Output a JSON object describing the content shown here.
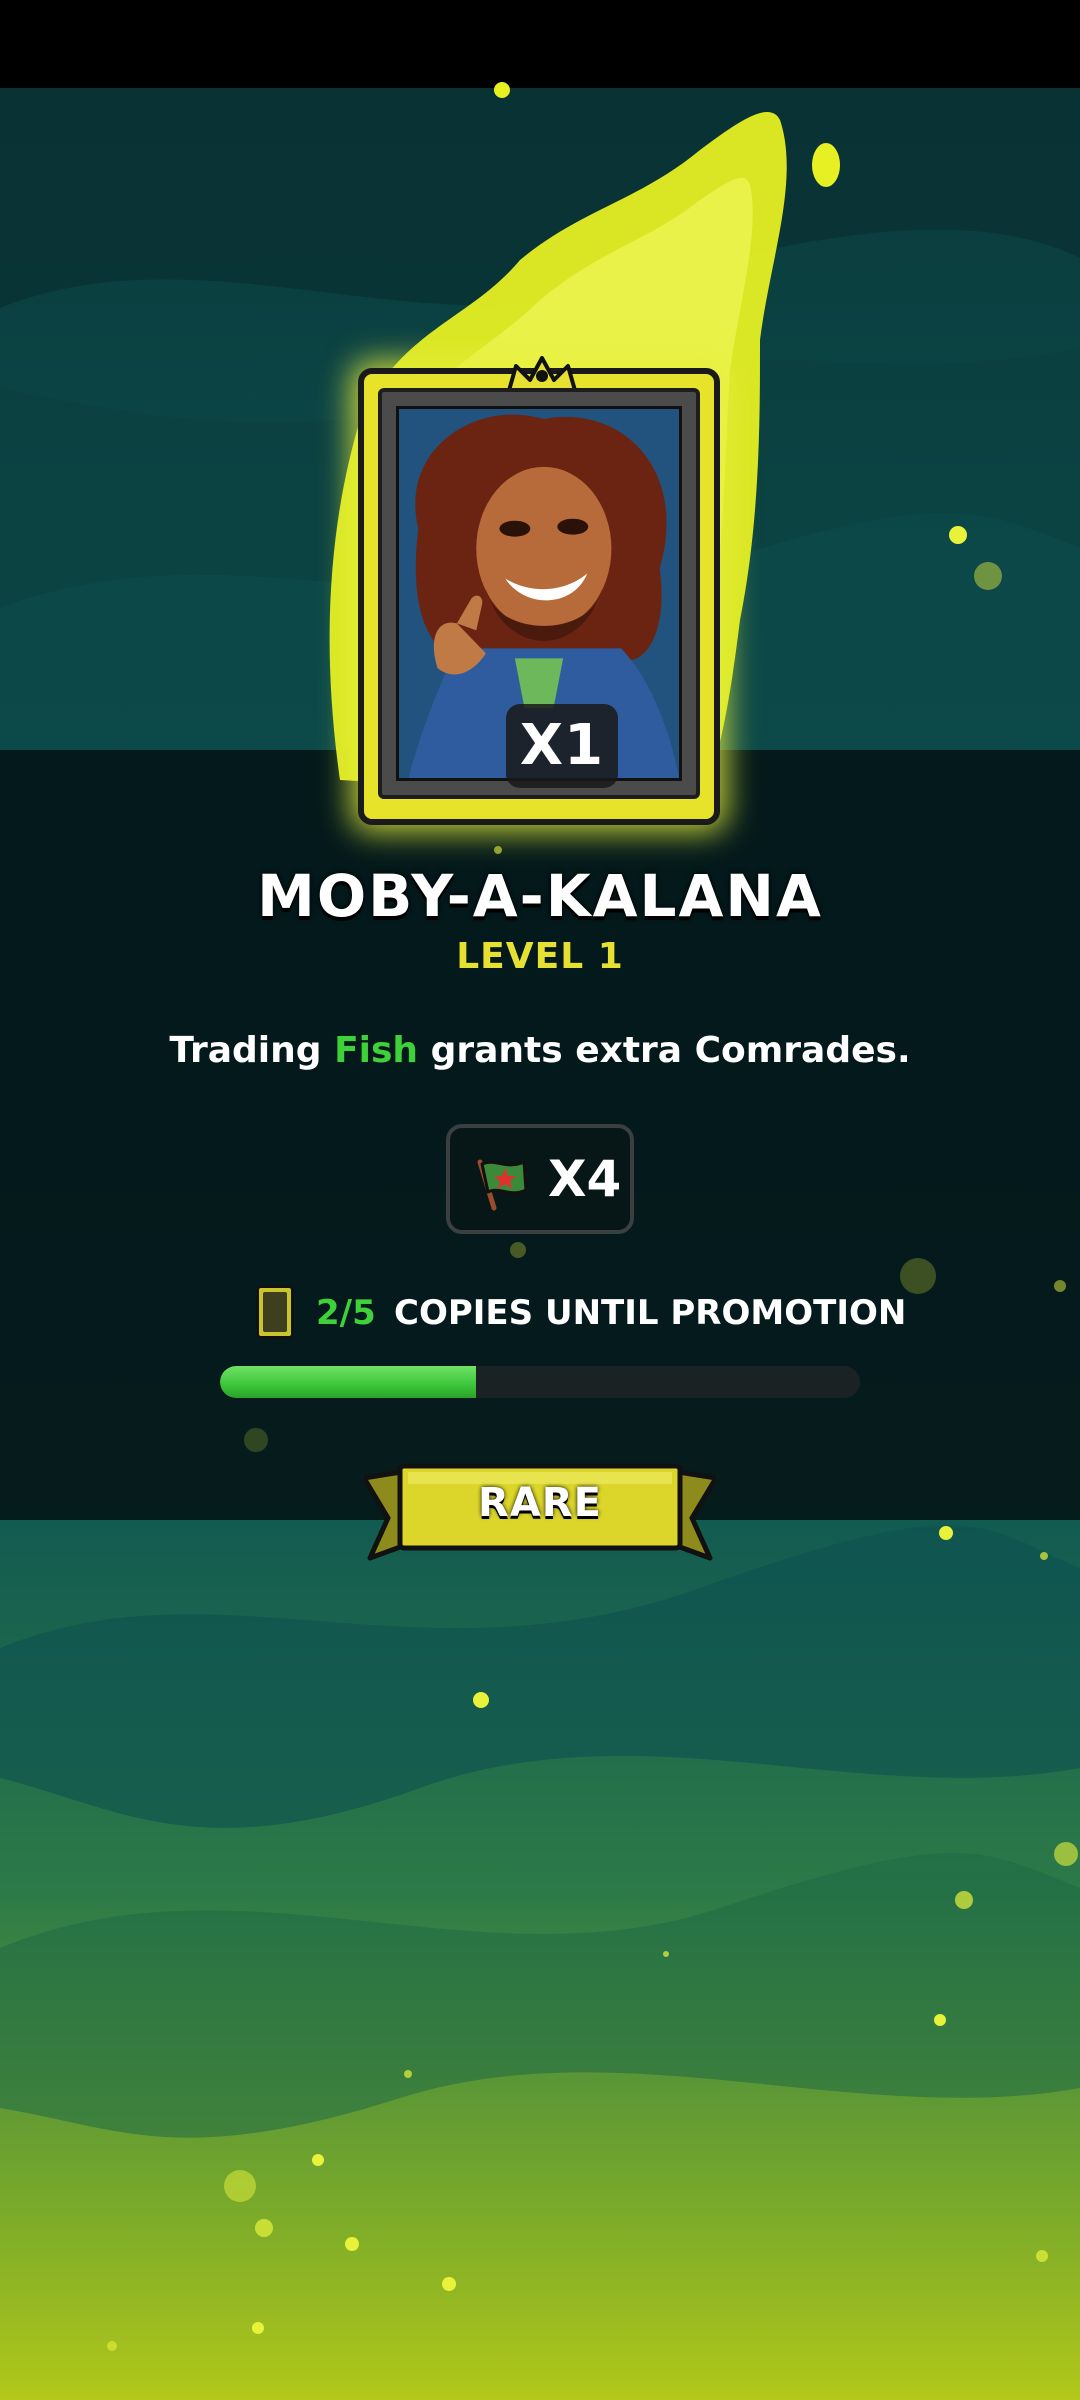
{
  "card": {
    "count": "X1",
    "name": "MOBY-A-KALANA",
    "level": "LEVEL 1",
    "rarity": "RARE"
  },
  "description": {
    "prefix": "Trading ",
    "highlight": "Fish",
    "suffix": " grants extra Comrades."
  },
  "reward": {
    "icon": "flag-icon",
    "amount": "X4"
  },
  "promotion": {
    "count": "2/5",
    "label": "COPIES UNTIL PROMOTION",
    "progress_fraction": 0.4
  },
  "colors": {
    "accent_yellow": "#e6e032",
    "highlight_green": "#3fd13a",
    "progress_green": "#3cc53a"
  }
}
